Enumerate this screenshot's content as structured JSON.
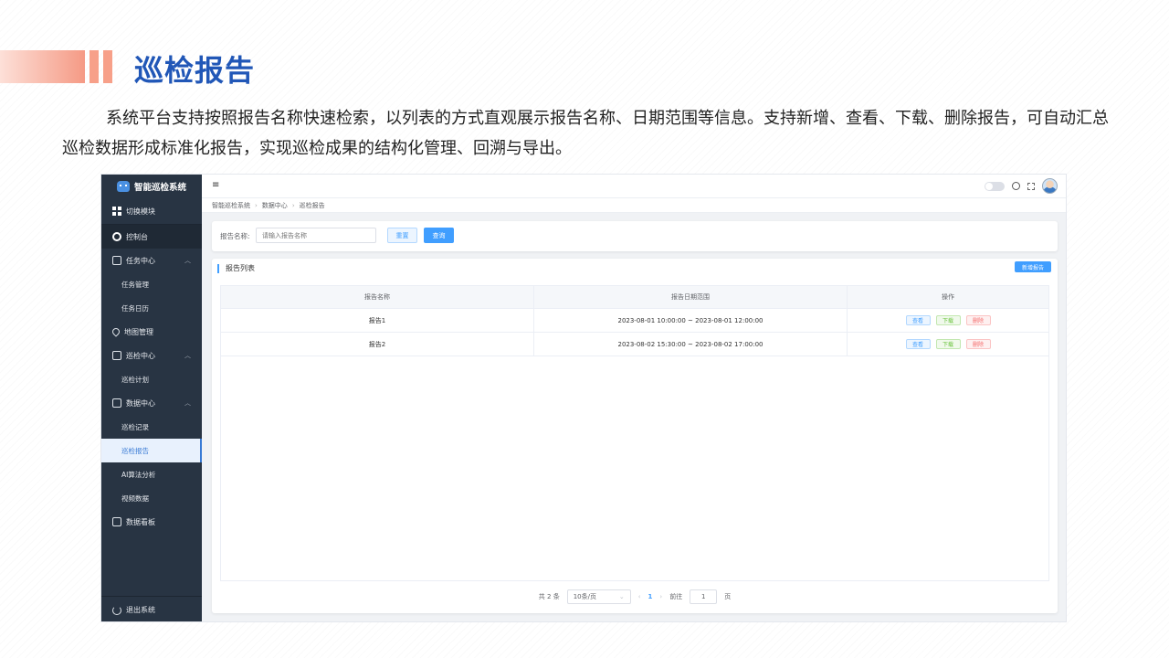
{
  "slide": {
    "title": "巡检报告",
    "description": "系统平台支持按照报告名称快速检索，以列表的方式直观展示报告名称、日期范围等信息。支持新增、查看、下载、删除报告，可自动汇总巡检数据形成标准化报告，实现巡检成果的结构化管理、回溯与导出。"
  },
  "app": {
    "logo_text": "智能巡检系统",
    "sidebar": {
      "switch_module": "切换模块",
      "console": "控制台",
      "task_center": "任务中心",
      "task_management": "任务管理",
      "task_calendar": "任务日历",
      "map_management": "地图管理",
      "inspection_center": "巡检中心",
      "inspection_plan": "巡检计划",
      "data_center": "数据中心",
      "inspection_records": "巡检记录",
      "inspection_reports": "巡检报告",
      "ai_analysis": "AI算法分析",
      "video_data": "视频数据",
      "data_dashboard": "数据看板",
      "logout": "退出系统"
    },
    "breadcrumb": [
      "智能巡检系统",
      "数据中心",
      "巡检报告"
    ],
    "search": {
      "label": "报告名称:",
      "placeholder": "请输入报告名称",
      "reset_label": "重置",
      "query_label": "查询"
    },
    "list": {
      "title": "报告列表",
      "new_button": "新增报告",
      "columns": [
        "报告名称",
        "报告日期范围",
        "操作"
      ],
      "rows": [
        {
          "name": "报告1",
          "range": "2023-08-01 10:00:00 ~ 2023-08-01 12:00:00"
        },
        {
          "name": "报告2",
          "range": "2023-08-02 15:30:00 ~ 2023-08-02 17:00:00"
        }
      ],
      "actions": {
        "view": "查看",
        "download": "下载",
        "delete": "删除"
      }
    },
    "pagination": {
      "total": "共 2 条",
      "page_size": "10条/页",
      "current_page": "1",
      "goto_label": "前往",
      "goto_value": "1",
      "page_suffix": "页"
    }
  }
}
